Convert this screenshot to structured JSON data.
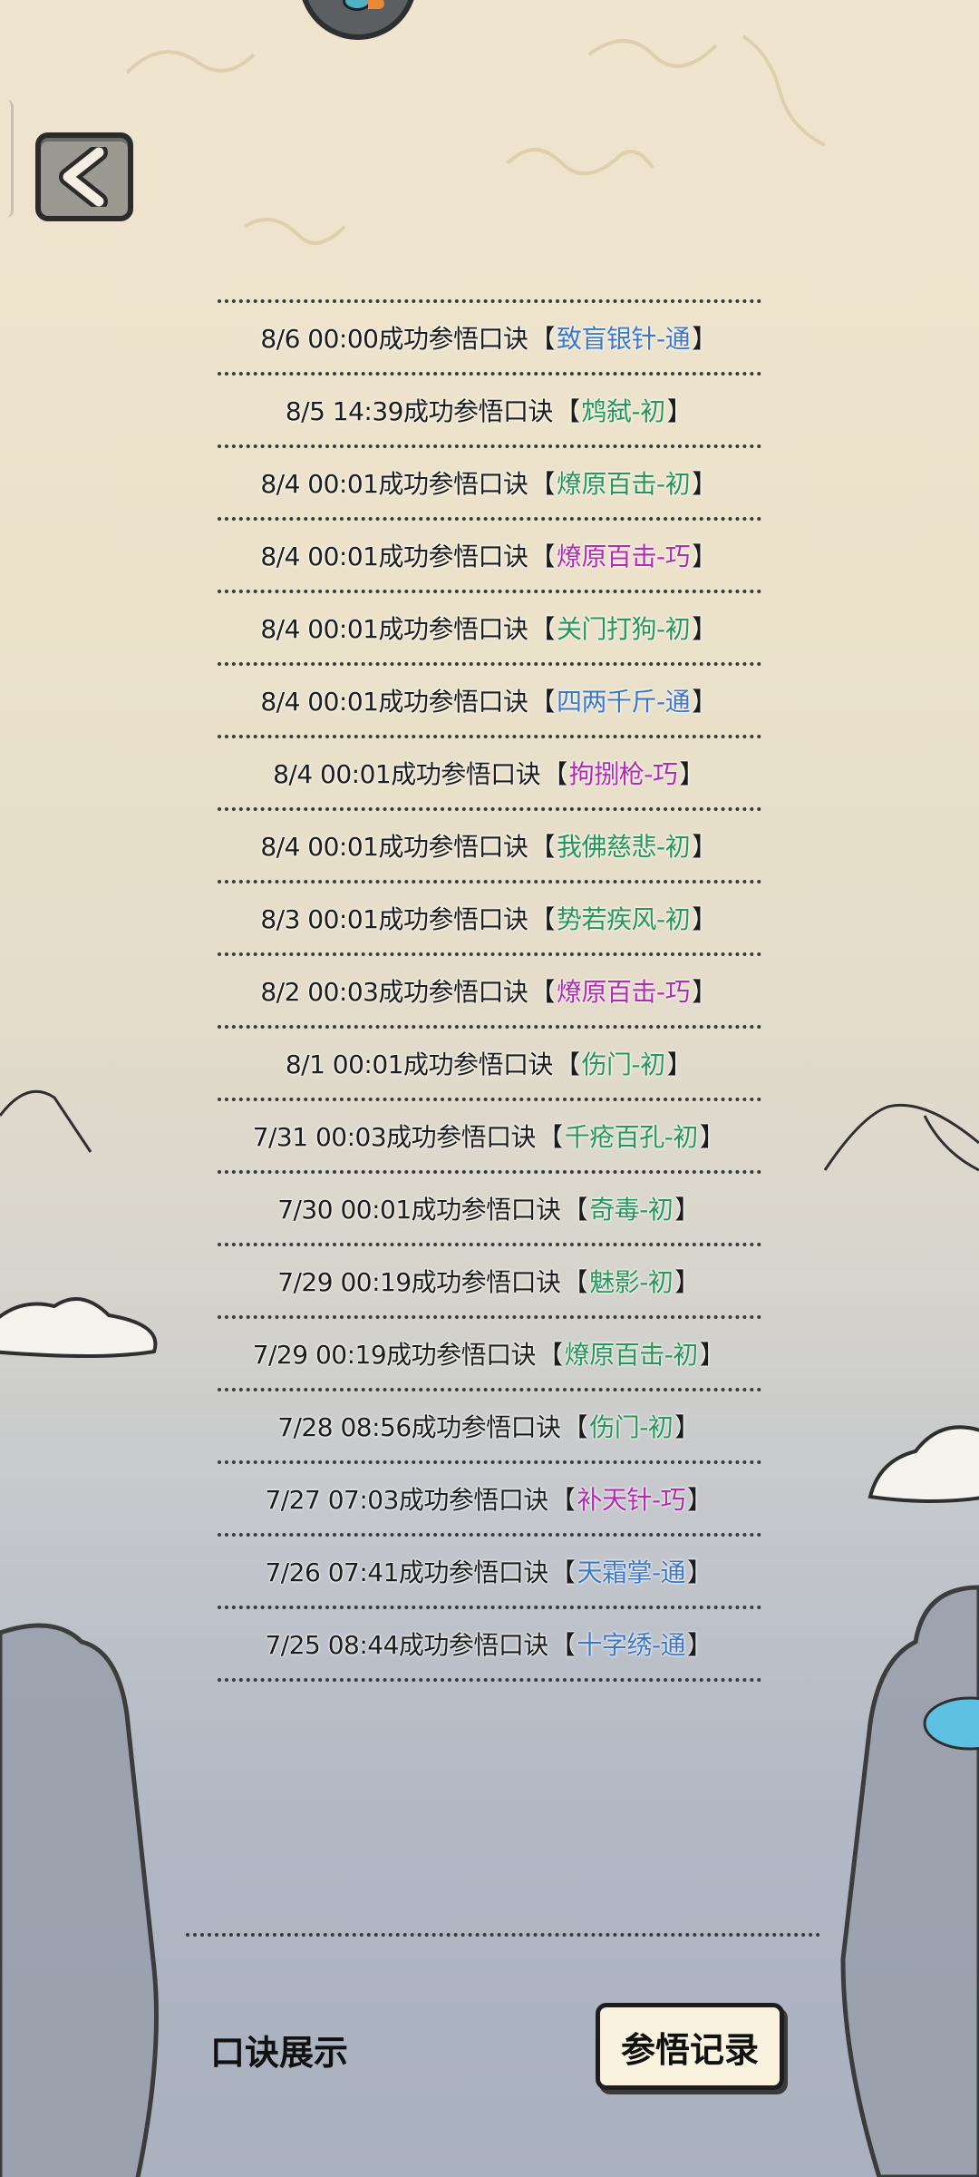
{
  "colors": {
    "tong": "#3d78c8",
    "chu": "#27965a",
    "qiao": "#b42bb0"
  },
  "icons": {
    "back": "chevron-left-icon",
    "mascot": "bird-mascot-icon"
  },
  "records": [
    {
      "time": "8/6 00:00成功参悟口诀",
      "skill": "致盲银针-通",
      "tier": "tong"
    },
    {
      "time": "8/5 14:39成功参悟口诀",
      "skill": "鸩弑-初",
      "tier": "chu"
    },
    {
      "time": "8/4 00:01成功参悟口诀",
      "skill": "燎原百击-初",
      "tier": "chu"
    },
    {
      "time": "8/4 00:01成功参悟口诀",
      "skill": "燎原百击-巧",
      "tier": "qiao"
    },
    {
      "time": "8/4 00:01成功参悟口诀",
      "skill": "关门打狗-初",
      "tier": "chu"
    },
    {
      "time": "8/4 00:01成功参悟口诀",
      "skill": "四两千斤-通",
      "tier": "tong"
    },
    {
      "time": "8/4 00:01成功参悟口诀",
      "skill": "拘捌枪-巧",
      "tier": "qiao"
    },
    {
      "time": "8/4 00:01成功参悟口诀",
      "skill": "我佛慈悲-初",
      "tier": "chu"
    },
    {
      "time": "8/3 00:01成功参悟口诀",
      "skill": "势若疾风-初",
      "tier": "chu"
    },
    {
      "time": "8/2 00:03成功参悟口诀",
      "skill": "燎原百击-巧",
      "tier": "qiao"
    },
    {
      "time": "8/1 00:01成功参悟口诀",
      "skill": "伤门-初",
      "tier": "chu"
    },
    {
      "time": "7/31 00:03成功参悟口诀",
      "skill": "千疮百孔-初",
      "tier": "chu"
    },
    {
      "time": "7/30 00:01成功参悟口诀",
      "skill": "奇毒-初",
      "tier": "chu"
    },
    {
      "time": "7/29 00:19成功参悟口诀",
      "skill": "魅影-初",
      "tier": "chu"
    },
    {
      "time": "7/29 00:19成功参悟口诀",
      "skill": "燎原百击-初",
      "tier": "chu"
    },
    {
      "time": "7/28 08:56成功参悟口诀",
      "skill": "伤门-初",
      "tier": "chu"
    },
    {
      "time": "7/27 07:03成功参悟口诀",
      "skill": "补天针-巧",
      "tier": "qiao"
    },
    {
      "time": "7/26 07:41成功参悟口诀",
      "skill": "天霜掌-通",
      "tier": "tong"
    },
    {
      "time": "7/25 08:44成功参悟口诀",
      "skill": "十字绣-通",
      "tier": "tong"
    }
  ],
  "tabs": {
    "display": "口诀展示",
    "record": "参悟记录"
  }
}
